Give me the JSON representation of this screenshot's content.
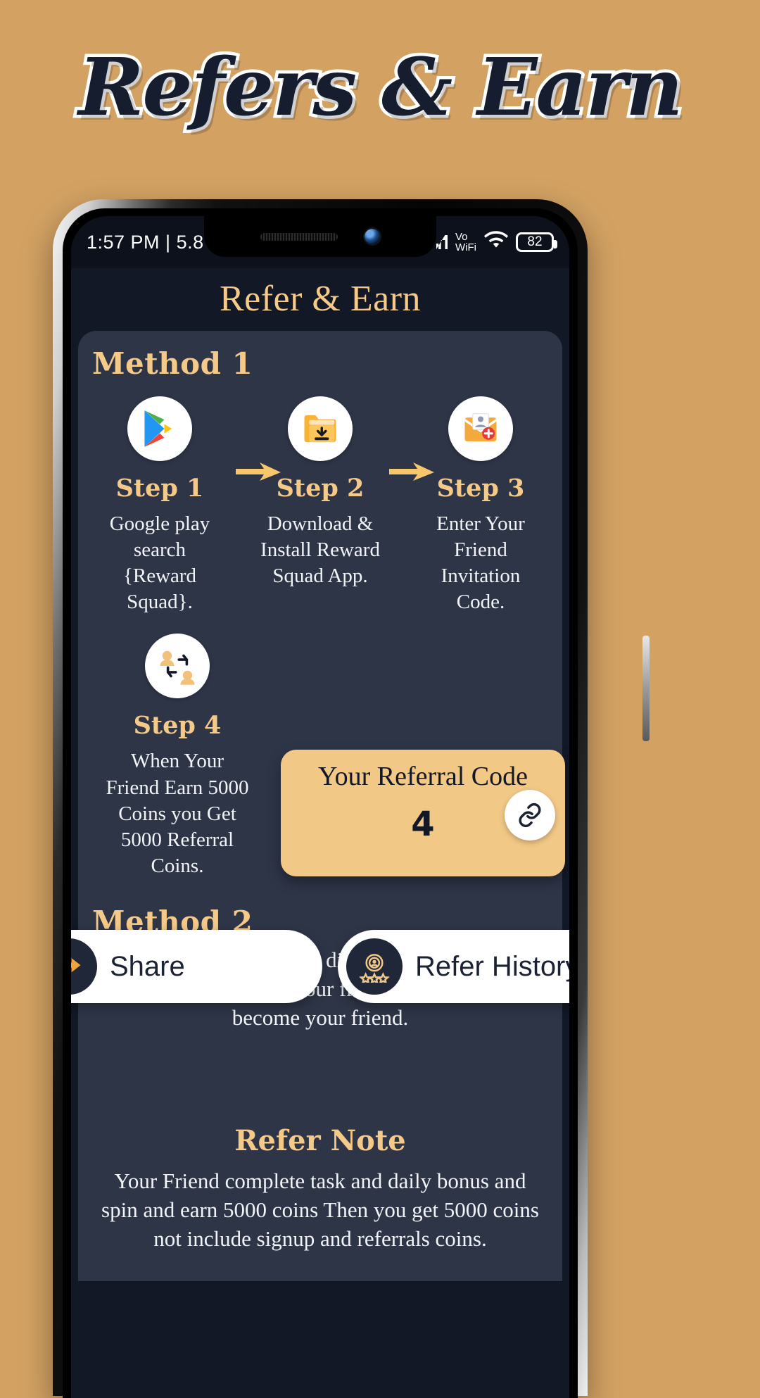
{
  "banner": {
    "title": "Refers & Earn"
  },
  "status_bar": {
    "time": "1:57 PM | 5.8",
    "network_label_top": "Vo",
    "network_label_bottom": "WiFi",
    "battery": "82",
    "signal_icon": "signal-bars-icon",
    "wifi_icon": "wifi-icon",
    "battery_icon": "battery-icon"
  },
  "app": {
    "header_title": "Refer & Earn",
    "method1": {
      "label": "Method 1",
      "steps": [
        {
          "icon": "google-play-icon",
          "title": "Step 1",
          "desc": "Google play search  {Reward Squad}."
        },
        {
          "icon": "folder-download-icon",
          "title": "Step 2",
          "desc": "Download & Install Reward Squad App."
        },
        {
          "icon": "invitation-mail-icon",
          "title": "Step 3",
          "desc": "Enter Your Friend Invitation Code."
        },
        {
          "icon": "referral-users-icon",
          "title": "Step 4",
          "desc": "When Your Friend Earn 5000 Coins you Get 5000 Referral Coins."
        }
      ],
      "arrow_icon": "arrow-right-icon"
    },
    "referral_card": {
      "title": "Your Referral Code",
      "code": "4",
      "copy_icon": "link-icon"
    },
    "method2": {
      "label": "Method 2",
      "desc": "Download & Register directly through your invite link and enter your friend invitation code become your friend."
    },
    "actions": [
      {
        "label": "Share",
        "icon": "share-icon"
      },
      {
        "label": "Refer History",
        "icon": "medal-icon"
      }
    ],
    "refer_note": {
      "title": "Refer Note",
      "body": "Your Friend complete task and daily bonus and spin and earn 5000 coins Then you get 5000 coins not include signup and referrals coins."
    }
  },
  "colors": {
    "page_background": "#d3a263",
    "screen_background": "#121826",
    "card_background": "#2e3547",
    "accent_gold": "#f5c987",
    "referral_card": "#f2c887",
    "text_light": "#f2f4f8"
  }
}
